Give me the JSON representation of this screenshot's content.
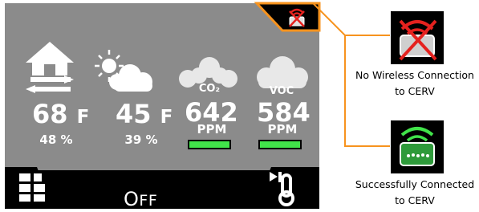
{
  "readings": [
    {
      "label": "Indoor",
      "value": "68",
      "unit": "F",
      "sub": "48 %"
    },
    {
      "label": "Outdoor",
      "value": "45",
      "unit": "F",
      "sub": "39 %"
    },
    {
      "label": "CO₂",
      "value": "642",
      "unit": "PPM",
      "badge": "CO₂",
      "level_color": "#41e34a"
    },
    {
      "label": "VOC",
      "value": "584",
      "unit": "PPM",
      "badge": "VOC",
      "level_color": "#41e34a"
    }
  ],
  "mode": {
    "first": "O",
    "rest": "FF"
  },
  "legend": [
    {
      "line1": "No Wireless Connection",
      "line2": "to CERV"
    },
    {
      "line1": "Successfully Connected",
      "line2": "to CERV"
    }
  ],
  "colors": {
    "screen_bg": "#8b8b8b",
    "accent": "#f7931e",
    "ok": "#41e34a",
    "error": "#e5221f"
  },
  "icons": [
    "home-icon",
    "partly-cloudy-icon",
    "co2-cloud-icon",
    "voc-cloud-icon",
    "menu-grid-icon",
    "thermostat-icon",
    "wireless-status-icon"
  ]
}
